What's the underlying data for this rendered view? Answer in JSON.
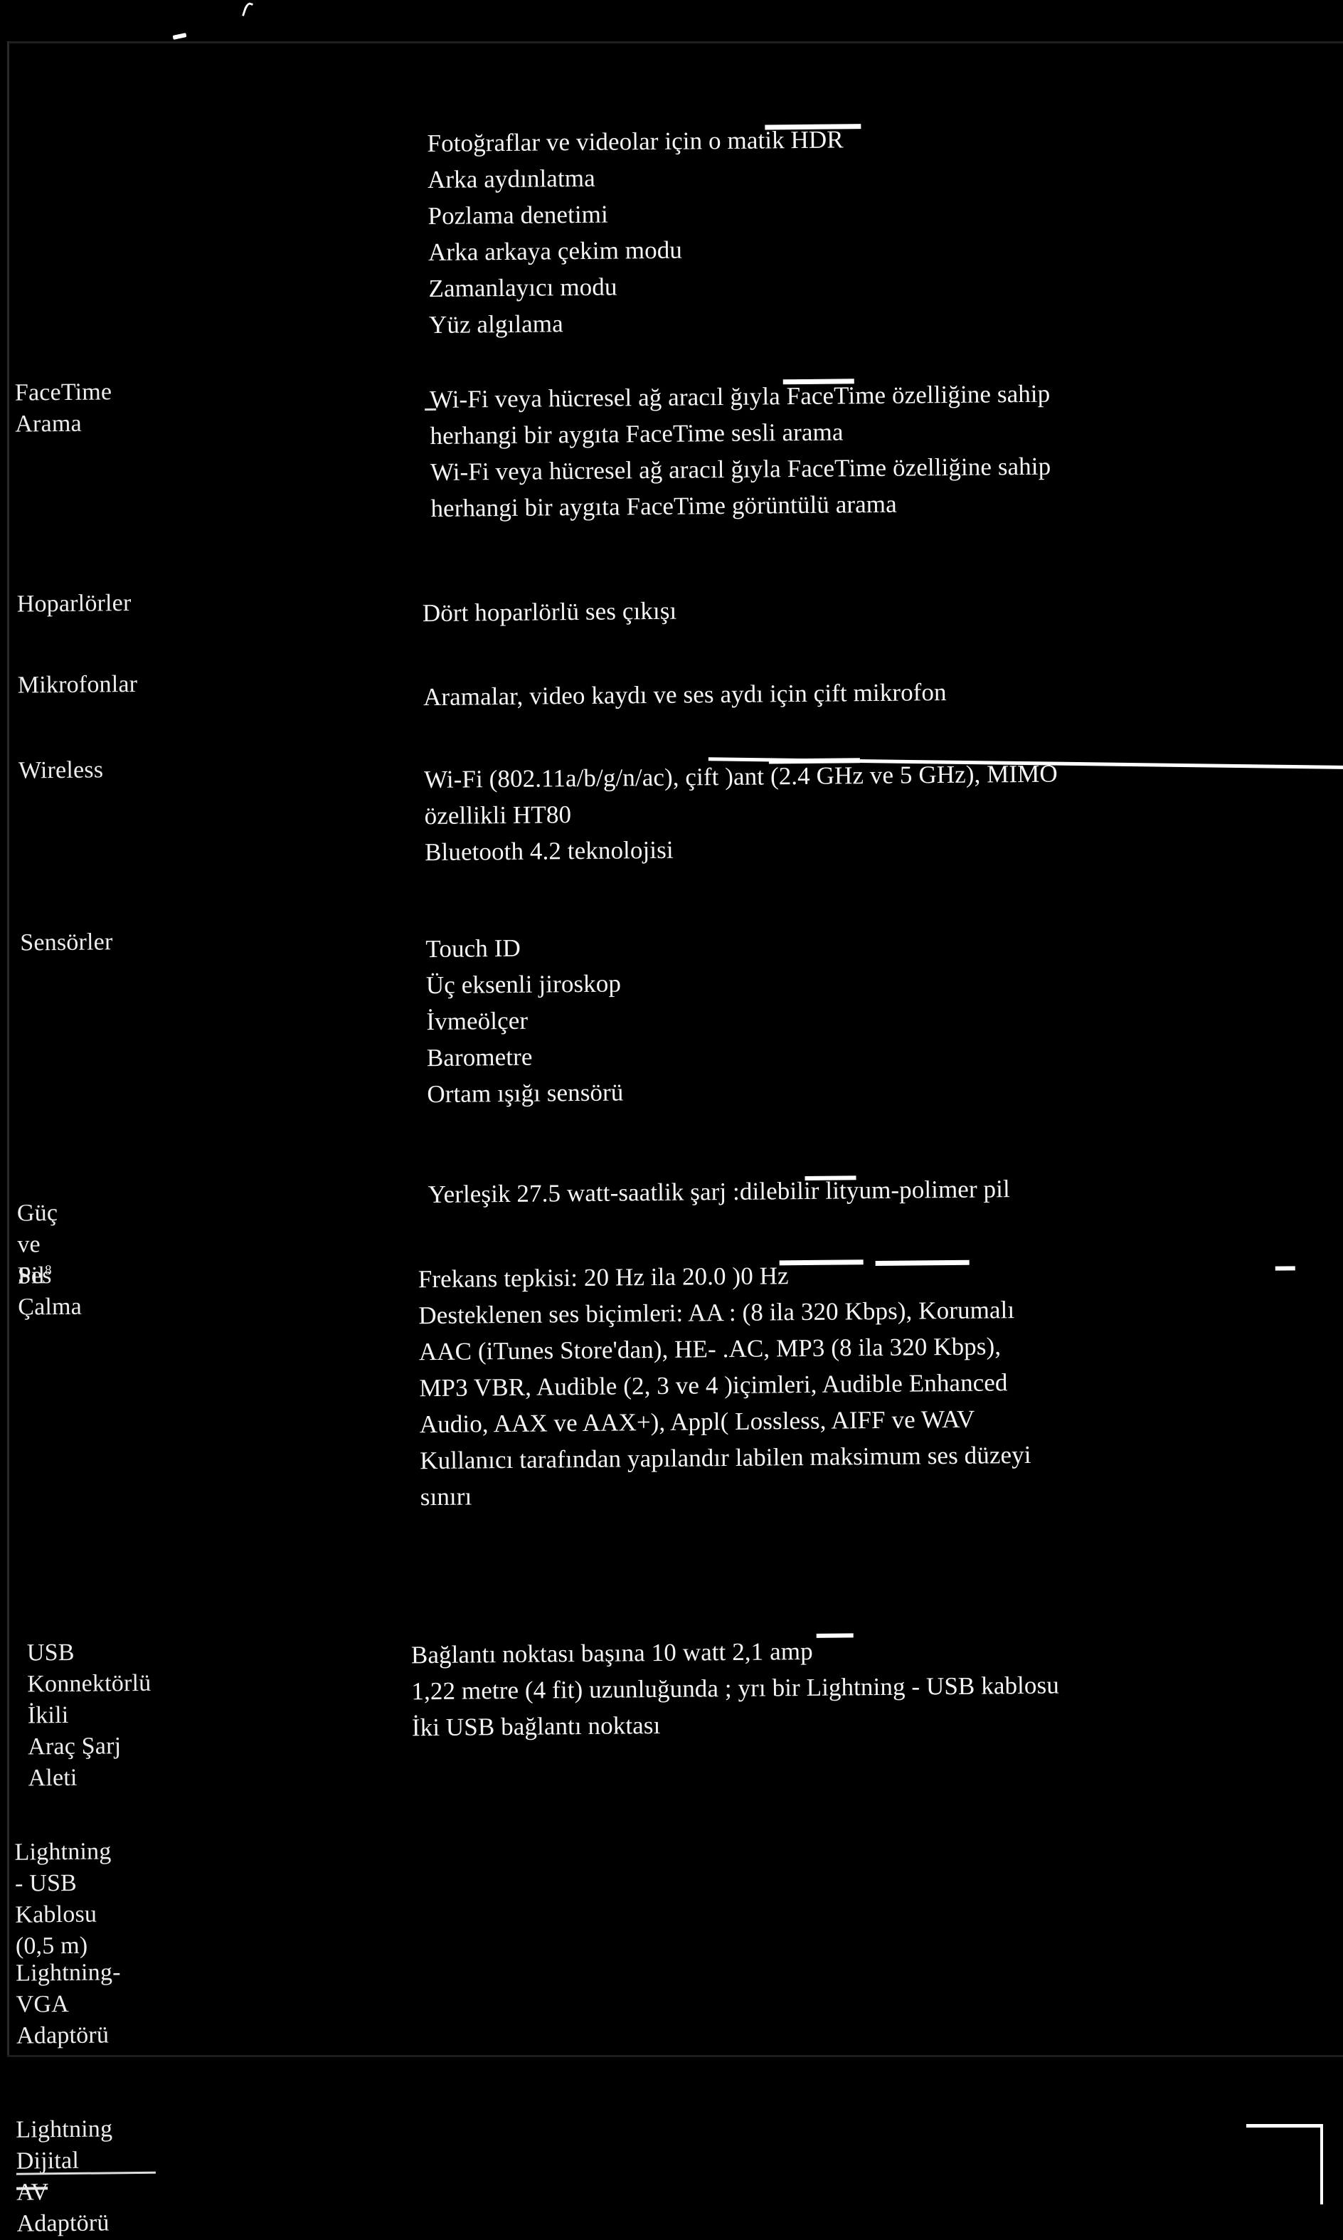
{
  "document": {
    "type": "scanned-specification-sheet",
    "language": "tr",
    "background_color": "#000000",
    "text_color": "#f5f5f5"
  },
  "rows": [
    {
      "label": "",
      "label_footnote": "",
      "lines": [
        "Fotoğraflar ve videolar için o   matik HDR",
        "Arka aydınlatma",
        "Pozlama denetimi",
        "Arka arkaya çekim modu",
        "Zamanlayıcı modu",
        "Yüz algılama"
      ]
    },
    {
      "label": "FaceTime Arama",
      "label_footnote": "",
      "lines": [
        "Wi-Fi veya hücresel ağ aracıl ğıyla FaceTime özelliğine sahip",
        "herhangi bir aygıta FaceTime sesli arama",
        "Wi-Fi veya hücresel ağ aracıl ğıyla FaceTime özelliğine sahip",
        "herhangi bir aygıta FaceTime görüntülü arama"
      ]
    },
    {
      "label": "Hoparlörler",
      "label_footnote": "",
      "lines": [
        "Dört hoparlörlü ses çıkışı"
      ]
    },
    {
      "label": "Mikrofonlar",
      "label_footnote": "",
      "lines": [
        "Aramalar, video kaydı ve ses  aydı için çift mikrofon"
      ]
    },
    {
      "label": "Wireless",
      "label_footnote": "",
      "lines": [
        "Wi-Fi (802.11a/b/g/n/ac), çift  )ant (2.4 GHz ve 5 GHz), MIMO",
        "özellikli HT80",
        "Bluetooth 4.2 teknolojisi"
      ]
    },
    {
      "label": "Sensörler",
      "label_footnote": "",
      "lines": [
        "Touch ID",
        "Üç eksenli jiroskop",
        "İvmeölçer",
        "Barometre",
        "Ortam ışığı sensörü"
      ]
    },
    {
      "label": "Güç ve Pil",
      "label_footnote": "8",
      "lines": [
        "Yerleşik 27.5 watt-saatlik şarj  :dilebilir lityum-polimer pil"
      ]
    },
    {
      "label": "Ses Çalma",
      "label_footnote": "",
      "lines": [
        "Frekans tepkisi: 20 Hz ila 20.0 )0 Hz",
        "Desteklenen ses biçimleri: AA ⁠: (8 ila 320 Kbps), Korumalı",
        "AAC (iTunes Store'dan), HE-⁠  .AC, MP3 (8 ila 320 Kbps),",
        "MP3 VBR, Audible (2, 3 ve 4  )içimleri, Audible Enhanced",
        "Audio, AAX ve AAX+), Appl(  Lossless, AIFF ve WAV",
        "Kullanıcı tarafından yapılandır labilen maksimum ses düzeyi",
        "sınırı"
      ]
    },
    {
      "label": "USB Konnektörlü İkili\nAraç Şarj Aleti",
      "label_footnote": "",
      "lines": [
        "Bağlantı noktası başına 10 watt 2,1 amp",
        "1,22 metre (4 fit) uzunluğunda ; yrı bir Lightning - USB kablosu",
        "İki USB bağlantı noktası"
      ]
    },
    {
      "label": "Lightning - USB\nKablosu (0,5 m)",
      "label_footnote": "",
      "lines": []
    },
    {
      "label": "Lightning-VGA\nAdaptörü",
      "label_footnote": "",
      "lines": []
    },
    {
      "label": "Lightning Dijital AV\nAdaptörü",
      "label_footnote": "",
      "lines": []
    }
  ]
}
